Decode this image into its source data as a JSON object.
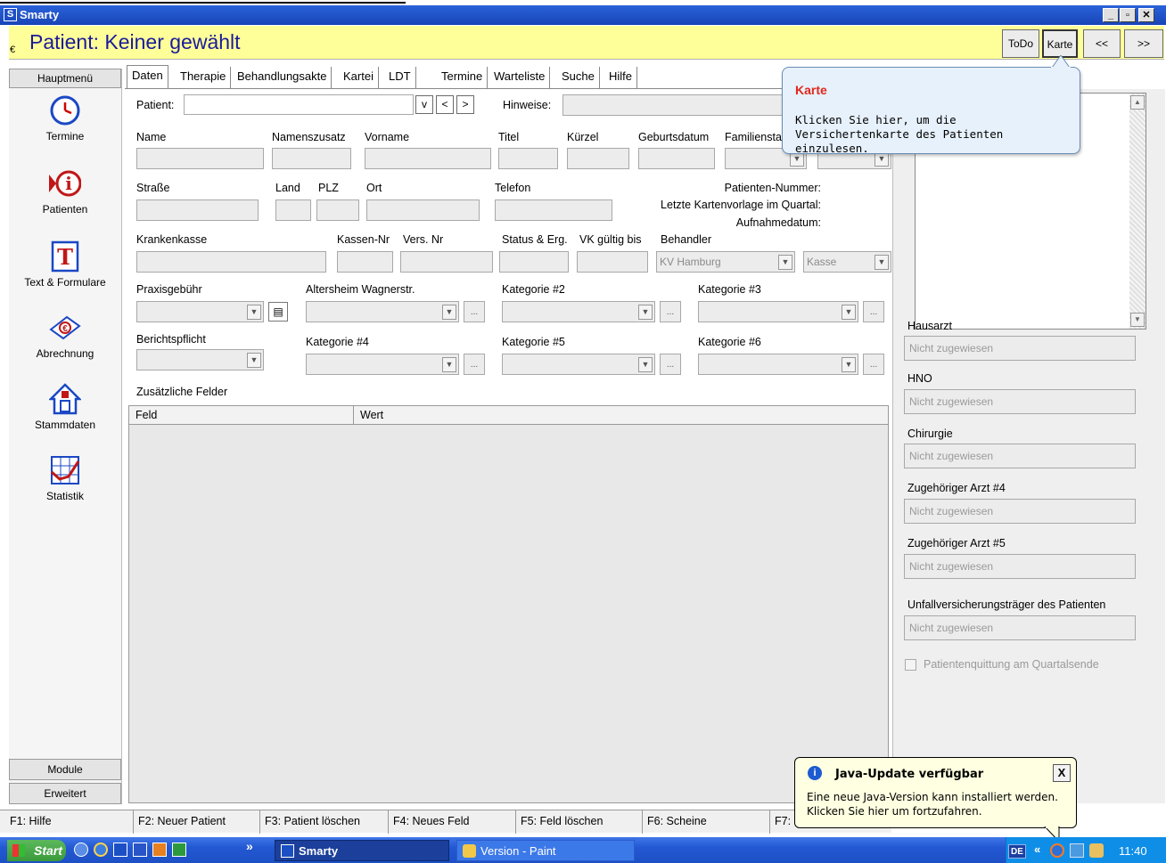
{
  "window": {
    "title": "Smarty",
    "app_icon": "S"
  },
  "header": {
    "title": "Patient: Keiner gewählt",
    "euro_symbol": "€",
    "todo_label": "ToDo",
    "karte_label": "Karte",
    "prev_label": "<<",
    "next_label": ">>"
  },
  "sidebar": {
    "menu_label": "Hauptmenü",
    "items": [
      {
        "label": "Termine",
        "icon": "clock-icon"
      },
      {
        "label": "Patienten",
        "icon": "info-icon"
      },
      {
        "label": "Text & Formulare",
        "icon": "text-icon"
      },
      {
        "label": "Abrechnung",
        "icon": "money-icon"
      },
      {
        "label": "Stammdaten",
        "icon": "house-icon"
      },
      {
        "label": "Statistik",
        "icon": "chart-icon"
      }
    ],
    "modules_label": "Module",
    "extended_label": "Erweitert"
  },
  "tabs": [
    "Daten",
    "Therapie",
    "Behandlungsakte",
    "Kartei",
    "LDT",
    "Termine",
    "Warteliste",
    "Suche",
    "Hilfe"
  ],
  "form": {
    "patient_label": "Patient:",
    "patient_v": "v",
    "patient_prev": "<",
    "patient_next": ">",
    "hinweise_label": "Hinweise:",
    "name": "Name",
    "namenszusatz": "Namenszusatz",
    "vorname": "Vorname",
    "titel": "Titel",
    "kuerzel": "Kürzel",
    "geburtsdatum": "Geburtsdatum",
    "familienstand": "Familiensta",
    "strasse": "Straße",
    "land": "Land",
    "plz": "PLZ",
    "ort": "Ort",
    "telefon": "Telefon",
    "patienten_nummer": "Patienten-Nummer:",
    "letzte_kartenvorlage": "Letzte Kartenvorlage im Quartal:",
    "aufnahmedatum": "Aufnahmedatum:",
    "krankenkasse": "Krankenkasse",
    "kassen_nr": "Kassen-Nr",
    "vers_nr": "Vers. Nr",
    "status": "Status & Erg.",
    "vk_gueltig": "VK gültig bis",
    "behandler": "Behandler",
    "behandler_value": "KV Hamburg",
    "kasse_value": "Kasse",
    "praxisgebuehr": "Praxisgebühr",
    "altersheim": "Altersheim Wagnerstr.",
    "kategorie2": "Kategorie #2",
    "kategorie3": "Kategorie #3",
    "berichtspflicht": "Berichtspflicht",
    "kategorie4": "Kategorie #4",
    "kategorie5": "Kategorie #5",
    "kategorie6": "Kategorie #6",
    "zusaetzliche": "Zusätzliche Felder",
    "grid_col_feld": "Feld",
    "grid_col_wert": "Wert"
  },
  "right_panel": {
    "hausarzt": "Hausarzt",
    "hno": "HNO",
    "chirurgie": "Chirurgie",
    "arzt4": "Zugehöriger Arzt #4",
    "arzt5": "Zugehöriger Arzt #5",
    "unfall": "Unfallversicherungsträger des Patienten",
    "not_assigned": "Nicht zugewiesen",
    "quittung": "Patientenquittung am Quartalsende"
  },
  "fkeys": [
    "F1: Hilfe",
    "F2: Neuer Patient",
    "F3: Patient löschen",
    "F4: Neues Feld",
    "F5: Feld löschen",
    "F6: Scheine",
    "F7:"
  ],
  "tooltip_karte": {
    "title": "Karte",
    "text": "Klicken Sie hier, um die Versichertenkarte des Patienten einzulesen."
  },
  "java_tip": {
    "title": "Java-Update verfügbar",
    "text": "Eine neue Java-Version kann installiert werden. Klicken Sie hier um fortzufahren.",
    "close": "X"
  },
  "taskbar": {
    "start": "Start",
    "chevron": "»",
    "task1": "Smarty",
    "task2": "Version - Paint",
    "lang": "DE",
    "tray_chevron": "«",
    "clock": "11:40"
  },
  "colors": {
    "title_blue": "#1845b8",
    "header_yellow": "#ffff99",
    "title_text": "#1a1a9a",
    "tooltip_red": "#e0281c"
  }
}
